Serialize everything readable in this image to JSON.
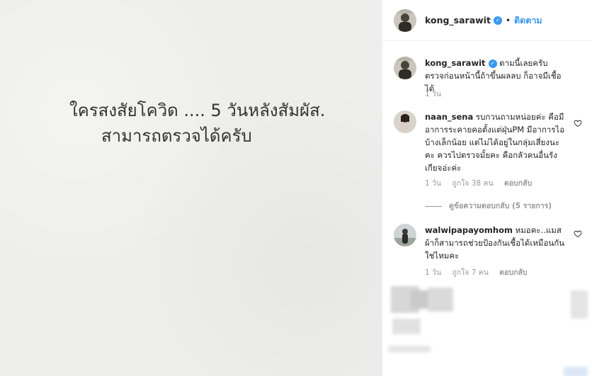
{
  "post": {
    "text_line1": "ใครสงสัยโควิด .... 5 วันหลังสัมผัส.",
    "text_line2": "สามารถตรวจได้ครับ"
  },
  "header": {
    "username": "kong_sarawit",
    "dot": "•",
    "follow_label": "ติดตาม"
  },
  "caption": {
    "username": "kong_sarawit",
    "text": "ตามนี้เลยครับ ตรวจก่อนหน้านี้ถ้าขึ้นผลลบ ก็อาจมีเชื้อได้",
    "time": "1 วัน"
  },
  "comments": [
    {
      "username": "naan_sena",
      "text": "รบกวนถามหน่อยค่ะ คือมีอาการระคายคอตั้งแต่ฝุ่นPM มีอาการไอบ้างเล็กน้อย แต่ไม่ได้อยู่ในกลุ่มเสี่ยงนะคะ ควรไปตรวจมั้ยคะ คือกลัวคนอื่นรังเกียจอ่ะค่ะ",
      "time": "1 วัน",
      "likes": "ถูกใจ 38 คน",
      "reply_label": "ตอบกลับ"
    },
    {
      "username": "walwipapayomhom",
      "text": "หมอคะ..แมสผ้าก็สามารถช่วยป้องกันเชื้อได้เหมือนกันใช่ไหมคะ",
      "time": "1 วัน",
      "likes": "ถูกใจ 7 คน",
      "reply_label": "ตอบกลับ"
    }
  ],
  "view_replies_label": "ดูข้อความตอบกลับ (5 รายการ)",
  "colors": {
    "link_blue": "#3897f0",
    "meta_gray": "#999999",
    "paper": "#eeeeec"
  }
}
